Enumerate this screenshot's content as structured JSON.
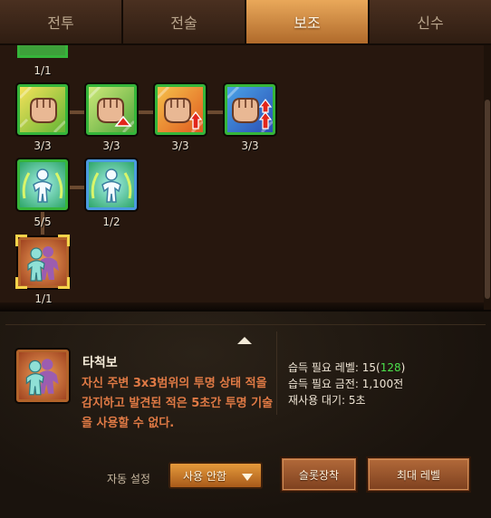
{
  "tabs": [
    {
      "label": "전투",
      "active": false
    },
    {
      "label": "전술",
      "active": false
    },
    {
      "label": "보조",
      "active": true
    },
    {
      "label": "신수",
      "active": false
    }
  ],
  "skill_tree": {
    "nodes": [
      {
        "icon": "fist-icon",
        "level": "3/3"
      },
      {
        "icon": "fist-red-arrow-icon",
        "level": "3/3"
      },
      {
        "icon": "fist-up-arrow-icon",
        "level": "3/3"
      },
      {
        "icon": "fist-double-up-arrow-icon",
        "level": "3/3"
      },
      {
        "icon": "stealth-figure-icon",
        "level": "5/5"
      },
      {
        "icon": "stealth-figure-blue-icon",
        "level": "1/2"
      },
      {
        "icon": "strike-stealth-icon",
        "level": "1/1",
        "selected": true
      }
    ],
    "top_partial_level": "1/1"
  },
  "detail": {
    "skill_name": "타척보",
    "description": "자신 주변 3x3범위의 투명 상태 적을 감지하고 발견된 적은 5초간 투명 기술을 사용할 수 없다.",
    "requirements": {
      "level_label": "습득 필요 레벨: 15(",
      "level_value": "128",
      "level_close": ")",
      "gold_label": "습득 필요 금전: 1,100전",
      "cooldown_label": "재사용 대기: 5초"
    },
    "auto_setting_label": "자동 설정",
    "auto_setting_value": "사용 안함",
    "slot_button": "슬롯장착",
    "max_level_button": "최대 레벨"
  },
  "colors": {
    "accent_orange": "#e59a3b",
    "description_text": "#e07a45",
    "highlight_green": "#4be04b",
    "node_border_green": "#35b53a",
    "node_border_blue": "#4a9be0",
    "selected_frame": "#f7d34a"
  }
}
